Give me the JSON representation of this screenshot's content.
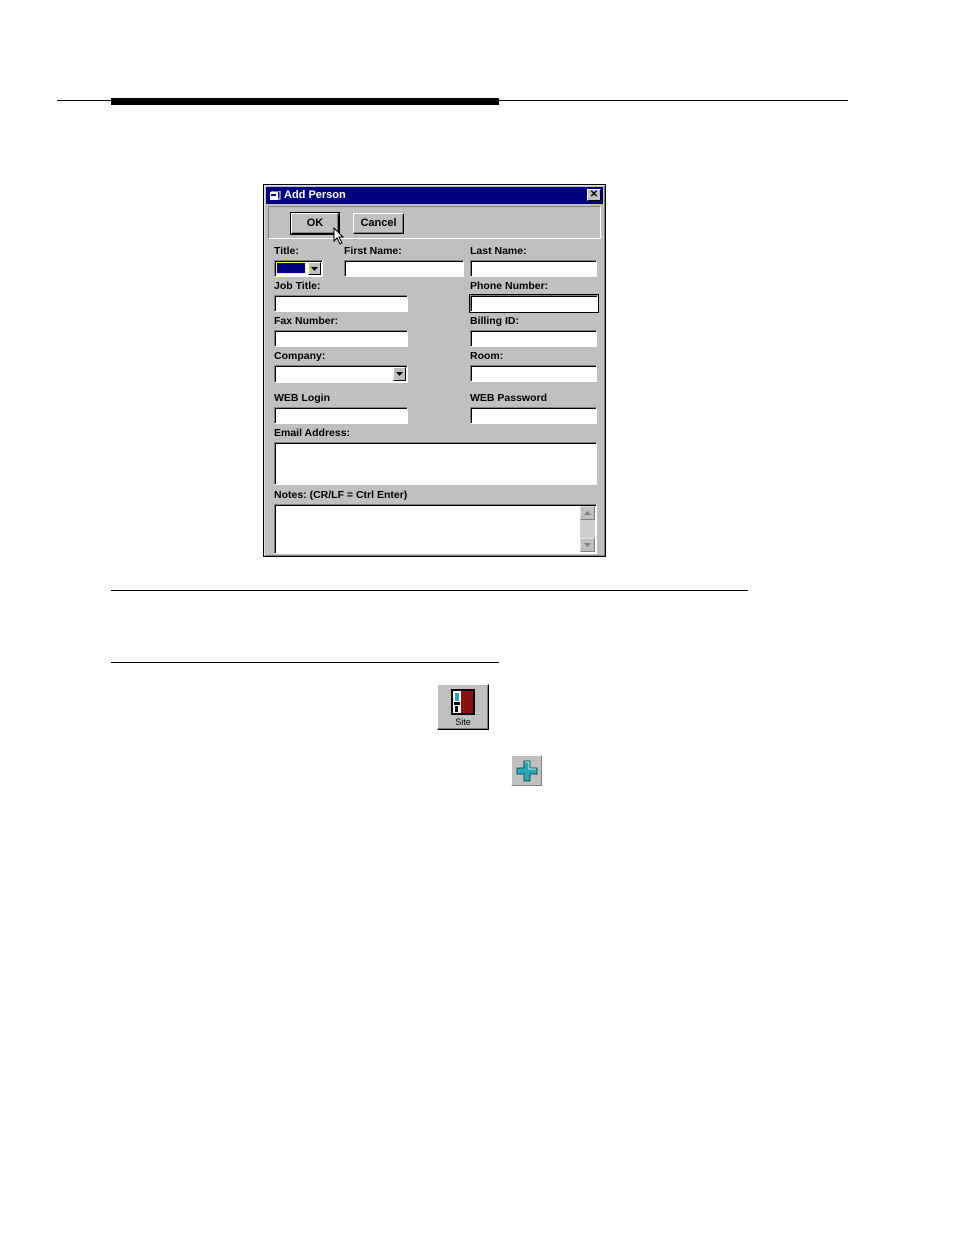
{
  "dialog": {
    "title": "Add Person",
    "ok_label": "OK",
    "cancel_label": "Cancel"
  },
  "form": {
    "title_label": "Title:",
    "first_name_label": "First Name:",
    "last_name_label": "Last Name:",
    "job_title_label": "Job Title:",
    "phone_label": "Phone Number:",
    "fax_label": "Fax Number:",
    "billing_label": "Billing ID:",
    "company_label": "Company:",
    "room_label": "Room:",
    "web_login_label": "WEB Login",
    "web_password_label": "WEB Password",
    "email_label": "Email Address:",
    "notes_label": "Notes: (CR/LF = Ctrl Enter)"
  },
  "icons": {
    "site_label": "Site",
    "site_icon": "site-icon",
    "add_icon": "plus-icon",
    "colors": {
      "titlebar": "#000080",
      "dialog_face": "#c0c0c0",
      "plus": "#2aa6b0"
    }
  }
}
